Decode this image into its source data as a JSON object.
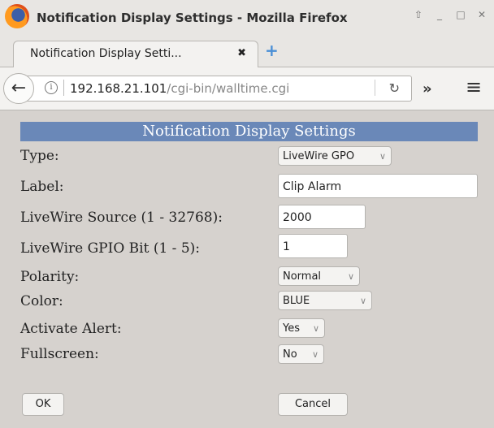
{
  "window": {
    "title": "Notification Display Settings - Mozilla Firefox"
  },
  "tab": {
    "label": "Notification Display Setti...",
    "close": "✖"
  },
  "url": {
    "host": "192.168.21.101",
    "path": "/cgi-bin/walltime.cgi"
  },
  "form": {
    "header": "Notification Display Settings",
    "type": {
      "label": "Type:",
      "value": "LiveWire GPO"
    },
    "label_field": {
      "label": "Label:",
      "value": "Clip Alarm"
    },
    "source": {
      "label": "LiveWire Source (1 - 32768):",
      "value": "2000"
    },
    "gpio_bit": {
      "label": "LiveWire GPIO Bit (1 - 5):",
      "value": "1"
    },
    "polarity": {
      "label": "Polarity:",
      "value": "Normal"
    },
    "color": {
      "label": "Color:",
      "value": "BLUE"
    },
    "activate_alert": {
      "label": "Activate Alert:",
      "value": "Yes"
    },
    "fullscreen": {
      "label": "Fullscreen:",
      "value": "No"
    },
    "ok": "OK",
    "cancel": "Cancel"
  },
  "colors": {
    "header_bg": "#6a88b8",
    "page_bg": "#d6d2ce"
  }
}
